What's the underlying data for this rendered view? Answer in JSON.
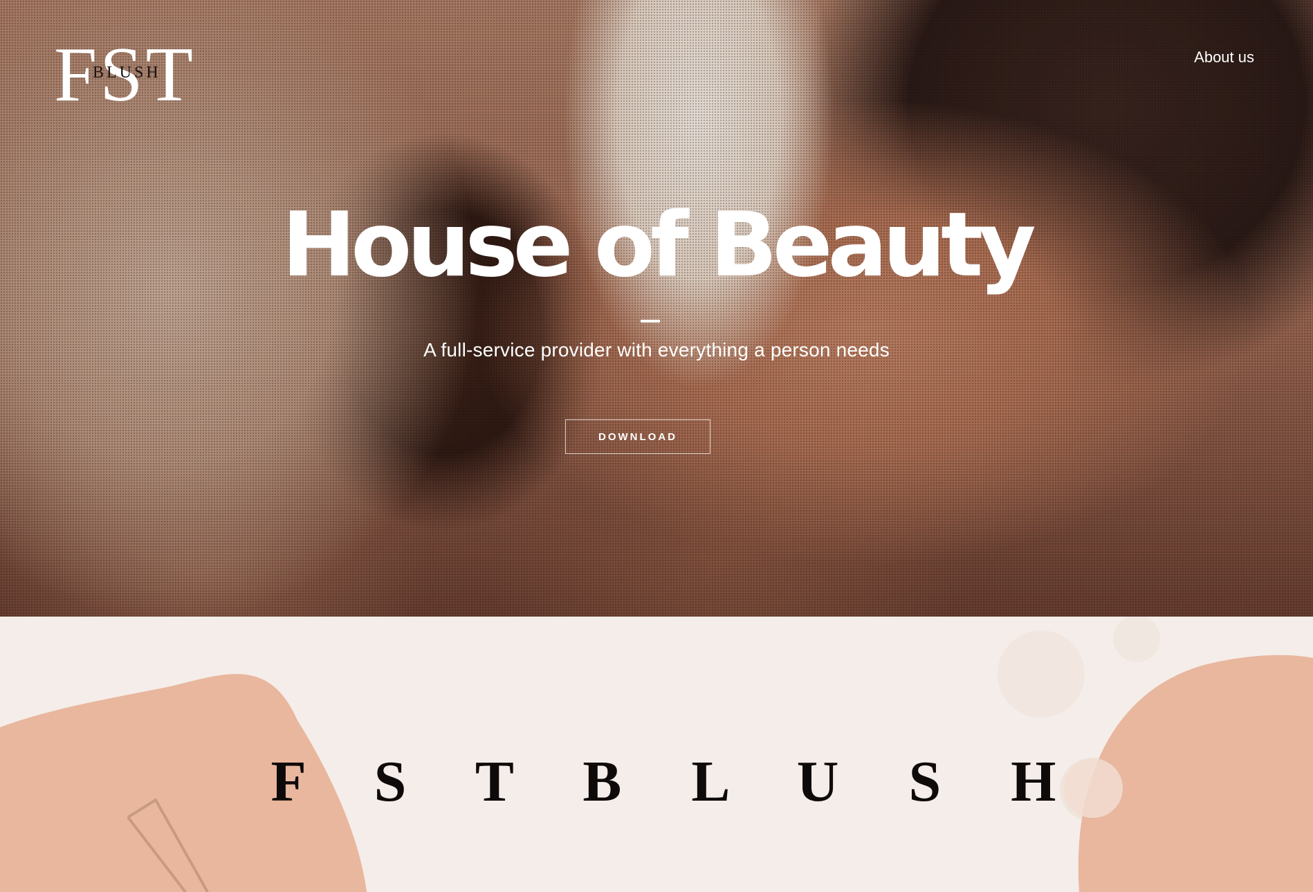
{
  "header": {
    "logo": {
      "big": "FST",
      "small": "BLUSH"
    },
    "nav": {
      "about_label": "About us"
    }
  },
  "hero": {
    "title": "House of Beauty",
    "subtitle": "A full-service provider with everything a person needs",
    "button_label": "DOWNLOAD"
  },
  "section": {
    "heading": "F S T B L U S H"
  },
  "colors": {
    "accent_peach": "#e8b79e",
    "background_cream": "#f5ede9",
    "text_dark": "#0e0a09",
    "hero_text": "#ffffff"
  },
  "icons": [
    "logo-mark",
    "decorative-blob-left",
    "decorative-blob-right",
    "decorative-circles",
    "decorative-line-art"
  ]
}
